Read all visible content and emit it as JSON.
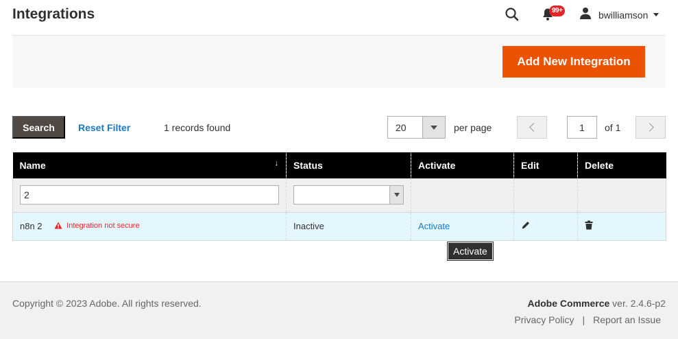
{
  "header": {
    "title": "Integrations",
    "notifications_count": "99+",
    "username": "bwilliamson"
  },
  "actions": {
    "add_new_label": "Add New Integration"
  },
  "grid_controls": {
    "search_label": "Search",
    "reset_filter_label": "Reset Filter",
    "records_found": "1 records found",
    "per_page_value": "20",
    "per_page_label": "per page",
    "current_page": "1",
    "of_pages": "of 1"
  },
  "table": {
    "columns": [
      "Name",
      "Status",
      "Activate",
      "Edit",
      "Delete"
    ],
    "sort_indicator": "↓",
    "filters": {
      "name": "2",
      "status": ""
    },
    "rows": [
      {
        "name": "n8n 2",
        "warning": "Integration not secure",
        "status": "Inactive",
        "activate": "Activate"
      }
    ]
  },
  "tooltip": "Activate",
  "footer": {
    "copyright": "Copyright © 2023 Adobe. All rights reserved.",
    "product": "Adobe Commerce",
    "version": " ver. 2.4.6-p2",
    "privacy": "Privacy Policy",
    "separator": "|",
    "report": "Report an Issue"
  },
  "colors": {
    "accent": "#eb5202",
    "link": "#1979c3",
    "warning": "#e22626",
    "header_bg": "#000000",
    "row_highlight": "#e5f7fe"
  },
  "icons": [
    "search-icon",
    "bell-icon",
    "user-icon",
    "warning-icon",
    "pencil-icon",
    "trash-icon",
    "chevron-left-icon",
    "chevron-right-icon"
  ]
}
